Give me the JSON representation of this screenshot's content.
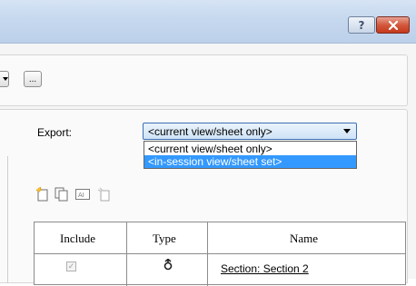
{
  "titlebar": {
    "help_label": "?",
    "close_label": "x"
  },
  "options_bar": {
    "browse_label": "..."
  },
  "export": {
    "label": "Export:",
    "selected": "<current view/sheet only>",
    "options": [
      "<current view/sheet only>",
      "<in-session view/sheet set>"
    ],
    "highlighted_index": 1
  },
  "tools": [
    "new-sheet-set-icon",
    "duplicate-sheet-set-icon",
    "rename-sheet-set-icon",
    "delete-sheet-set-icon"
  ],
  "table": {
    "columns": [
      "Include",
      "Type",
      "Name"
    ],
    "rows": [
      {
        "include": true,
        "type_icon": "section-view-icon",
        "name": "Section: Section 2"
      }
    ]
  },
  "colors": {
    "accent": "#3399ff",
    "close": "#c5391c"
  }
}
